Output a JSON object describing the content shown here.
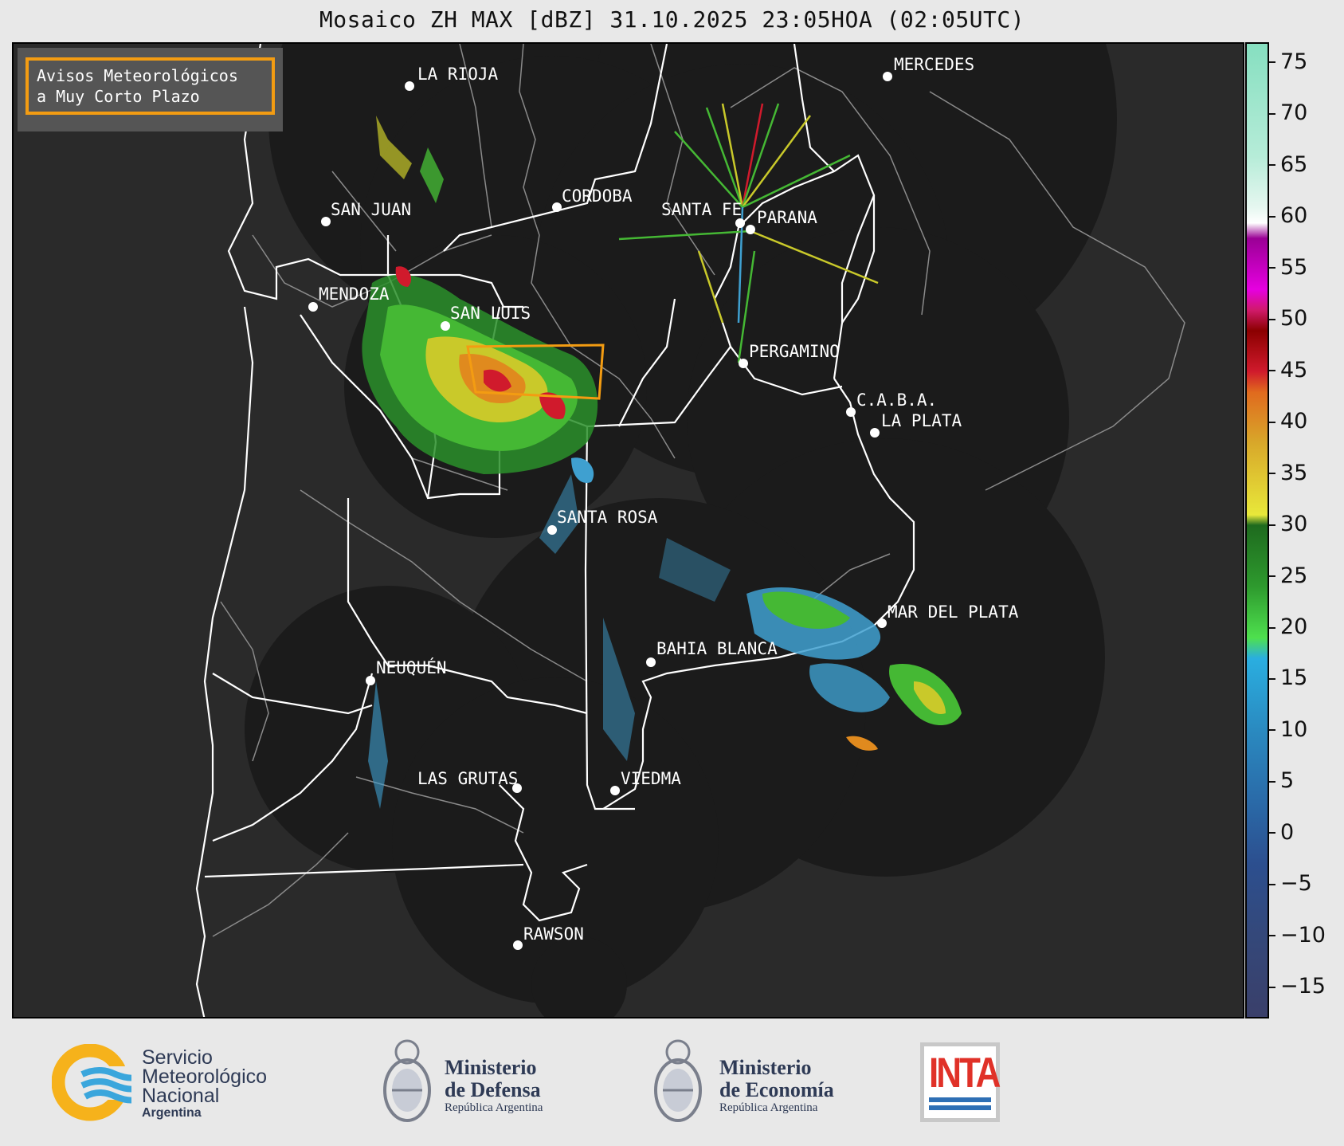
{
  "title": "Mosaico ZH MAX [dBZ] 31.10.2025 23:05HOA (02:05UTC)",
  "alert_box": {
    "text": "Avisos Meteorológicos\na Muy Corto Plazo",
    "border_color": "#f39c12"
  },
  "cities": [
    {
      "name": "LA RIOJA"
    },
    {
      "name": "MERCEDES"
    },
    {
      "name": "CORDOBA"
    },
    {
      "name": "SAN JUAN"
    },
    {
      "name": "SANTA FE"
    },
    {
      "name": "PARANA"
    },
    {
      "name": "MENDOZA"
    },
    {
      "name": "SAN LUIS"
    },
    {
      "name": "PERGAMINO"
    },
    {
      "name": "C.A.B.A."
    },
    {
      "name": "LA PLATA"
    },
    {
      "name": "SANTA ROSA"
    },
    {
      "name": "MAR DEL PLATA"
    },
    {
      "name": "BAHIA BLANCA"
    },
    {
      "name": "NEUQUÉN"
    },
    {
      "name": "LAS GRUTAS"
    },
    {
      "name": "VIEDMA"
    },
    {
      "name": "RAWSON"
    }
  ],
  "colorbar": {
    "ticks": [
      "75",
      "70",
      "65",
      "60",
      "55",
      "50",
      "45",
      "40",
      "35",
      "30",
      "25",
      "20",
      "15",
      "10",
      "5",
      "0",
      "−5",
      "−10",
      "−15"
    ],
    "range": [
      -18,
      77
    ]
  },
  "logos": {
    "smn": {
      "line1": "Servicio",
      "line2": "Meteorológico",
      "line3": "Nacional",
      "line4": "Argentina"
    },
    "defensa": {
      "line1": "Ministerio",
      "line2": "de Defensa",
      "line3": "República Argentina"
    },
    "economia": {
      "line1": "Ministerio",
      "line2": "de Economía",
      "line3": "República Argentina"
    },
    "inta": {
      "text": "INTA"
    }
  }
}
